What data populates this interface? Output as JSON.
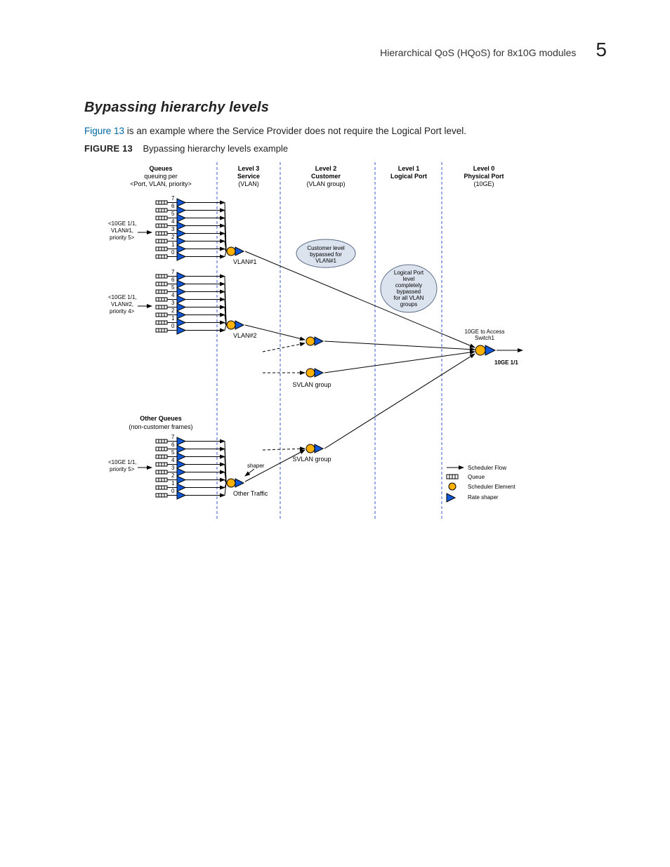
{
  "header": {
    "title": "Hierarchical QoS (HQoS) for 8x10G modules",
    "chapter_number": "5"
  },
  "section": {
    "heading": "Bypassing hierarchy levels",
    "paragraph_pre": "",
    "figref": "Figure 13",
    "paragraph_post": " is an example where the Service Provider does not require the Logical Port level."
  },
  "figure": {
    "label": "FIGURE 13",
    "caption": "Bypassing hierarchy levels example"
  },
  "diagram": {
    "columns": {
      "queues": {
        "h1": "Queues",
        "h2": "queuing per",
        "h3": "<Port, VLAN, priority>"
      },
      "level3": {
        "h1": "Level 3",
        "h2": "Service",
        "h3": "(VLAN)"
      },
      "level2": {
        "h1": "Level 2",
        "h2": "Customer",
        "h3": "(VLAN group)"
      },
      "level1": {
        "h1": "Level 1",
        "h2": "Logical Port",
        "h3": ""
      },
      "level0": {
        "h1": "Level 0",
        "h2": "Physical Port",
        "h3": "(10GE)"
      }
    },
    "queue_numbers": [
      "7",
      "6",
      "5",
      "4",
      "3",
      "2",
      "1",
      "0"
    ],
    "group1_label": [
      "<10GE 1/1,",
      "VLAN#1,",
      "priority 5>"
    ],
    "group2_label": [
      "<10GE 1/1,",
      "VLAN#2,",
      "priority 4>"
    ],
    "group3_label": [
      "<10GE 1/1,",
      "priority 5>"
    ],
    "other_queues_h": "Other Queues",
    "other_queues_s": "(non-customer frames)",
    "vlan1": "VLAN#1",
    "vlan2": "VLAN#2",
    "svlan": "SVLAN group",
    "other_traffic": "Other Traffic",
    "shaper": "shaper",
    "bubble_cust": [
      "Customer level",
      "bypassed for",
      "VLAN#1"
    ],
    "bubble_lp": [
      "Logical Port",
      "level",
      "completely",
      "bypassed",
      "for all VLAN",
      "groups"
    ],
    "port_out_top": "10GE to Access",
    "port_out_top2": "Switch1",
    "port_out": "10GE 1/1",
    "legend": {
      "flow": "Scheduler Flow",
      "queue": "Queue",
      "elem": "Scheduler Element",
      "rate": "Rate shaper"
    }
  }
}
